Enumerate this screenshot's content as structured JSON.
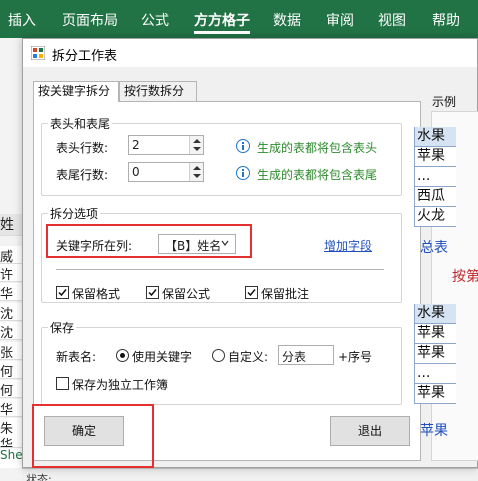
{
  "ribbon": {
    "tabs": [
      "插入",
      "页面布局",
      "公式",
      "方方格子",
      "数据",
      "审阅",
      "视图",
      "帮助"
    ],
    "active_tab": "方方格子"
  },
  "sheet": {
    "header_cell": "姓",
    "names": [
      "威",
      "许",
      "华",
      "沈",
      "沈",
      "张",
      "何",
      "何",
      "华",
      "朱",
      "华"
    ],
    "tab": "She",
    "status": "状态:"
  },
  "dialog": {
    "title": "拆分工作表",
    "tabs": [
      "按关键字拆分",
      "按行数拆分"
    ],
    "header_group": {
      "title": "表头和表尾",
      "header_rows_label": "表头行数:",
      "header_rows_value": "2",
      "footer_rows_label": "表尾行数:",
      "footer_rows_value": "0",
      "header_hint": "生成的表都将包含表头",
      "footer_hint": "生成的表都将包含表尾"
    },
    "split_group": {
      "title": "拆分选项",
      "key_column_label": "关键字所在列:",
      "key_column_value": "【B】姓名",
      "add_field_link": "增加字段",
      "keep_format": "保留格式",
      "keep_formula": "保留公式",
      "keep_comment": "保留批注"
    },
    "save_group": {
      "title": "保存",
      "new_name_label": "新表名:",
      "use_keyword": "使用关键字",
      "custom": "自定义:",
      "custom_value": "分表",
      "suffix": "+序号",
      "save_workbook": "保存为独立工作簿"
    },
    "ok_button": "确定",
    "exit_button": "退出"
  },
  "example": {
    "label": "示例",
    "table1": [
      "水果",
      "苹果",
      "...",
      "西瓜",
      "火龙"
    ],
    "tab1": "总表",
    "note": "按第",
    "table2": [
      "水果",
      "苹果",
      "苹果",
      "...",
      "苹果"
    ],
    "tab2": "苹果"
  },
  "colors": {
    "excel_green": "#217346",
    "hint_green": "#2d8a2d",
    "link_blue": "#1f4fbf",
    "highlight_red": "#e53030"
  }
}
